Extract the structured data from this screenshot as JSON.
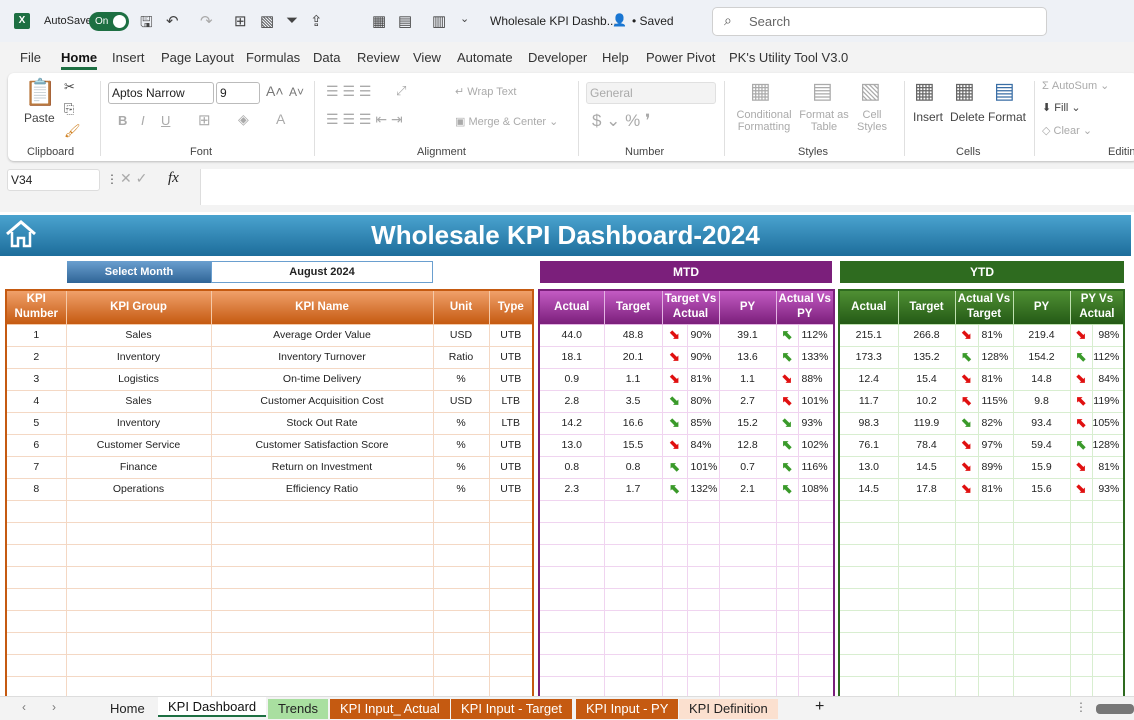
{
  "titlebar": {
    "autosave": "AutoSave",
    "toggle": "On",
    "filename": "Wholesale KPI Dashb...",
    "saved": "• Saved",
    "search_placeholder": "Search"
  },
  "menu": [
    "File",
    "Home",
    "Insert",
    "Page Layout",
    "Formulas",
    "Data",
    "Review",
    "View",
    "Automate",
    "Developer",
    "Help",
    "Power Pivot",
    "PK's Utility Tool V3.0"
  ],
  "ribbon": {
    "paste": "Paste",
    "clipboard": "Clipboard",
    "font_name": "Aptos Narrow",
    "font_size": "9",
    "font": "Font",
    "wrap": "Wrap Text",
    "merge": "Merge & Center",
    "alignment": "Alignment",
    "number_format": "General",
    "number": "Number",
    "cond": "Conditional",
    "formatting": "Formatting",
    "format_as": "Format as",
    "table": "Table",
    "cell": "Cell",
    "styles_l": "Styles",
    "styles": "Styles",
    "insert": "Insert",
    "delete": "Delete",
    "format": "Format",
    "cells": "Cells",
    "autosum": "AutoSum",
    "fill": "Fill",
    "clear": "Clear",
    "editing": "Editin"
  },
  "formula": {
    "namebox": "V34",
    "fx": "fx",
    "value": ""
  },
  "dashboard": {
    "title": "Wholesale KPI Dashboard-2024",
    "select_month": "Select Month",
    "month": "August 2024",
    "mtd": "MTD",
    "ytd": "YTD"
  },
  "colors": {
    "kpi": "#c55a11",
    "mtd": "#7b1f7b",
    "ytd": "#2e6b1f",
    "banner": "#1d6d9b"
  },
  "kpi_headers": [
    "KPI Number",
    "KPI Group",
    "KPI Name",
    "Unit",
    "Type"
  ],
  "mtd_headers": [
    "Actual",
    "Target",
    "Target Vs Actual",
    "PY",
    "Actual Vs PY"
  ],
  "ytd_headers": [
    "Actual",
    "Target",
    "Actual Vs Target",
    "PY",
    "PY Vs Actual"
  ],
  "rows": [
    {
      "num": "1",
      "group": "Sales",
      "name": "Average Order Value",
      "unit": "USD",
      "type": "UTB",
      "mtd": {
        "actual": "44.0",
        "target": "48.8",
        "tva": "90%",
        "tva_icon": "arrow-down-red",
        "py": "39.1",
        "avp": "112%",
        "avp_icon": "arrow-up-green"
      },
      "ytd": {
        "actual": "215.1",
        "target": "266.8",
        "avt": "81%",
        "avt_icon": "arrow-down-red",
        "py": "219.4",
        "pva": "98%",
        "pva_icon": "arrow-down-red"
      }
    },
    {
      "num": "2",
      "group": "Inventory",
      "name": "Inventory Turnover",
      "unit": "Ratio",
      "type": "UTB",
      "mtd": {
        "actual": "18.1",
        "target": "20.1",
        "tva": "90%",
        "tva_icon": "arrow-down-red",
        "py": "13.6",
        "avp": "133%",
        "avp_icon": "arrow-up-green"
      },
      "ytd": {
        "actual": "173.3",
        "target": "135.2",
        "avt": "128%",
        "avt_icon": "arrow-up-green",
        "py": "154.2",
        "pva": "112%",
        "pva_icon": "arrow-up-green"
      }
    },
    {
      "num": "3",
      "group": "Logistics",
      "name": "On-time Delivery",
      "unit": "%",
      "type": "UTB",
      "mtd": {
        "actual": "0.9",
        "target": "1.1",
        "tva": "81%",
        "tva_icon": "arrow-down-red",
        "py": "1.1",
        "avp": "88%",
        "avp_icon": "arrow-down-red"
      },
      "ytd": {
        "actual": "12.4",
        "target": "15.4",
        "avt": "81%",
        "avt_icon": "arrow-down-red",
        "py": "14.8",
        "pva": "84%",
        "pva_icon": "arrow-down-red"
      }
    },
    {
      "num": "4",
      "group": "Sales",
      "name": "Customer Acquisition Cost",
      "unit": "USD",
      "type": "LTB",
      "mtd": {
        "actual": "2.8",
        "target": "3.5",
        "tva": "80%",
        "tva_icon": "arrow-down-green",
        "py": "2.7",
        "avp": "101%",
        "avp_icon": "arrow-up-red"
      },
      "ytd": {
        "actual": "11.7",
        "target": "10.2",
        "avt": "115%",
        "avt_icon": "arrow-up-red",
        "py": "9.8",
        "pva": "119%",
        "pva_icon": "arrow-up-red"
      }
    },
    {
      "num": "5",
      "group": "Inventory",
      "name": "Stock Out Rate",
      "unit": "%",
      "type": "LTB",
      "mtd": {
        "actual": "14.2",
        "target": "16.6",
        "tva": "85%",
        "tva_icon": "arrow-down-green",
        "py": "15.2",
        "avp": "93%",
        "avp_icon": "arrow-down-green"
      },
      "ytd": {
        "actual": "98.3",
        "target": "119.9",
        "avt": "82%",
        "avt_icon": "arrow-down-green",
        "py": "93.4",
        "pva": "105%",
        "pva_icon": "arrow-up-red"
      }
    },
    {
      "num": "6",
      "group": "Customer Service",
      "name": "Customer Satisfaction Score",
      "unit": "%",
      "type": "UTB",
      "mtd": {
        "actual": "13.0",
        "target": "15.5",
        "tva": "84%",
        "tva_icon": "arrow-down-red",
        "py": "12.8",
        "avp": "102%",
        "avp_icon": "arrow-up-green"
      },
      "ytd": {
        "actual": "76.1",
        "target": "78.4",
        "avt": "97%",
        "avt_icon": "arrow-down-red",
        "py": "59.4",
        "pva": "128%",
        "pva_icon": "arrow-up-green"
      }
    },
    {
      "num": "7",
      "group": "Finance",
      "name": "Return on Investment",
      "unit": "%",
      "type": "UTB",
      "mtd": {
        "actual": "0.8",
        "target": "0.8",
        "tva": "101%",
        "tva_icon": "arrow-up-green",
        "py": "0.7",
        "avp": "116%",
        "avp_icon": "arrow-up-green"
      },
      "ytd": {
        "actual": "13.0",
        "target": "14.5",
        "avt": "89%",
        "avt_icon": "arrow-down-red",
        "py": "15.9",
        "pva": "81%",
        "pva_icon": "arrow-down-red"
      }
    },
    {
      "num": "8",
      "group": "Operations",
      "name": "Efficiency Ratio",
      "unit": "%",
      "type": "UTB",
      "mtd": {
        "actual": "2.3",
        "target": "1.7",
        "tva": "132%",
        "tva_icon": "arrow-up-green",
        "py": "2.1",
        "avp": "108%",
        "avp_icon": "arrow-up-green"
      },
      "ytd": {
        "actual": "14.5",
        "target": "17.8",
        "avt": "81%",
        "avt_icon": "arrow-down-red",
        "py": "15.6",
        "pva": "93%",
        "pva_icon": "arrow-down-red"
      }
    }
  ],
  "sheet_tabs": [
    {
      "label": "Home",
      "bg": "#f3f3f3",
      "fg": "#222"
    },
    {
      "label": "KPI Dashboard",
      "bg": "#ffffff",
      "fg": "#111",
      "active": true
    },
    {
      "label": "Trends",
      "bg": "#a9dfa0",
      "fg": "#222"
    },
    {
      "label": "KPI Input_ Actual",
      "bg": "#c55a11",
      "fg": "#fff"
    },
    {
      "label": "KPI Input - Target",
      "bg": "#c55a11",
      "fg": "#fff"
    },
    {
      "label": "KPI Input - PY",
      "bg": "#c55a11",
      "fg": "#fff"
    },
    {
      "label": "KPI Definition",
      "bg": "#fbe0cf",
      "fg": "#222"
    }
  ]
}
